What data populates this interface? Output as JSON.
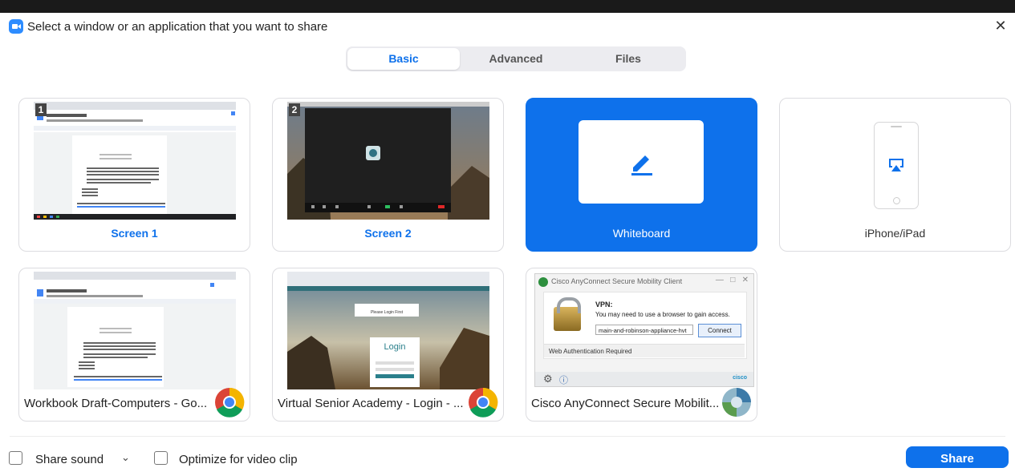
{
  "window": {
    "title": "Select a window or an application that you want to share"
  },
  "tabs": [
    {
      "label": "Basic",
      "active": true
    },
    {
      "label": "Advanced",
      "active": false
    },
    {
      "label": "Files",
      "active": false
    }
  ],
  "cards": {
    "screen1": {
      "label": "Screen 1",
      "badge": "1"
    },
    "screen2": {
      "label": "Screen 2",
      "badge": "2"
    },
    "whiteboard": {
      "label": "Whiteboard"
    },
    "iphone": {
      "label": "iPhone/iPad"
    },
    "workbook": {
      "label": "Workbook Draft-Computers - Go...",
      "thumb_title": "Workbook Draft-Computers"
    },
    "academy": {
      "label": "Virtual Senior Academy - Login - ...",
      "thumb_banner": "Please Login First",
      "thumb_login": "Login"
    },
    "cisco": {
      "label": "Cisco AnyConnect Secure Mobilit...",
      "window_title": "Cisco AnyConnect Secure Mobility Client",
      "vpn_heading": "VPN:",
      "vpn_message": "You may need to use a browser to gain access.",
      "server": "main-and-robinson-appliance-hvt",
      "connect_label": "Connect",
      "status": "Web Authentication Required",
      "brand": "cisco"
    }
  },
  "footer": {
    "share_sound_label": "Share sound",
    "optimize_label": "Optimize for video clip",
    "share_button": "Share"
  },
  "colors": {
    "accent": "#0e71eb",
    "selected_card": "#0e71eb"
  },
  "icons": {
    "app": "zoom-icon",
    "close": "close-icon",
    "whiteboard": "pen-icon",
    "airplay": "airplay-icon",
    "chrome": "chrome-icon",
    "cisco": "cisco-anyconnect-icon",
    "dropdown": "chevron-down-icon"
  }
}
